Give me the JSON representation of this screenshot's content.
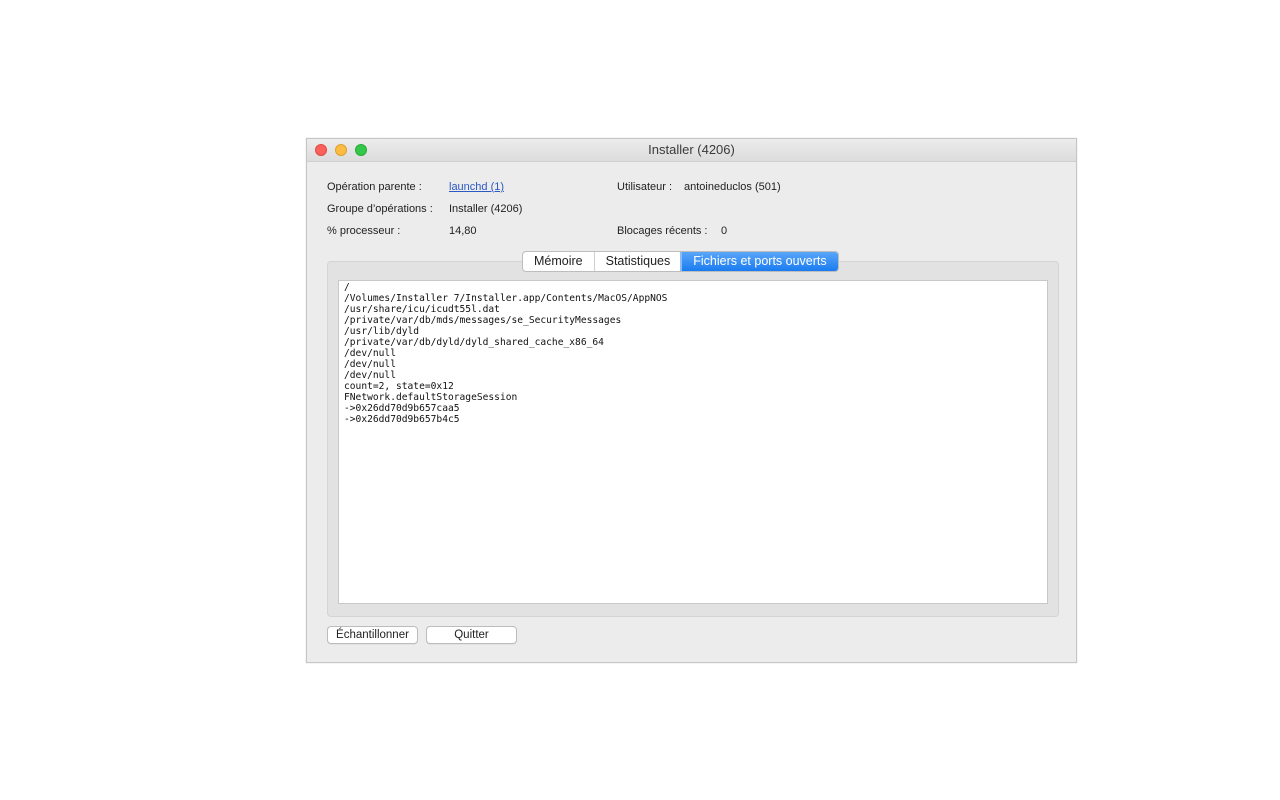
{
  "window": {
    "title": "Installer (4206)"
  },
  "info": {
    "parent_label": "Opération parente :",
    "parent_value": "launchd (1)",
    "group_label": "Groupe d’opérations :",
    "group_value": "Installer (4206)",
    "cpu_label": "% processeur :",
    "cpu_value": "14,80",
    "user_label": "Utilisateur :",
    "user_value": "antoineduclos (501)",
    "hangs_label": "Blocages récents :",
    "hangs_value": "0"
  },
  "tabs": [
    {
      "label": "Mémoire",
      "active": false
    },
    {
      "label": "Statistiques",
      "active": false
    },
    {
      "label": "Fichiers et ports ouverts",
      "active": true
    }
  ],
  "files": [
    "/",
    "/Volumes/Installer 7/Installer.app/Contents/MacOS/AppNOS",
    "/usr/share/icu/icudt55l.dat",
    "/private/var/db/mds/messages/se_SecurityMessages",
    "/usr/lib/dyld",
    "/private/var/db/dyld/dyld_shared_cache_x86_64",
    "/dev/null",
    "/dev/null",
    "/dev/null",
    "count=2, state=0x12",
    "FNetwork.defaultStorageSession",
    "->0x26dd70d9b657caa5",
    "->0x26dd70d9b657b4c5"
  ],
  "buttons": {
    "sample": "Échantillonner",
    "quit": "Quitter"
  },
  "colors": {
    "active_tab": "#1a7cf0",
    "link": "#2b59c3",
    "close": "#fc605b",
    "minimize": "#fdbc40",
    "maximize": "#34c84a"
  }
}
